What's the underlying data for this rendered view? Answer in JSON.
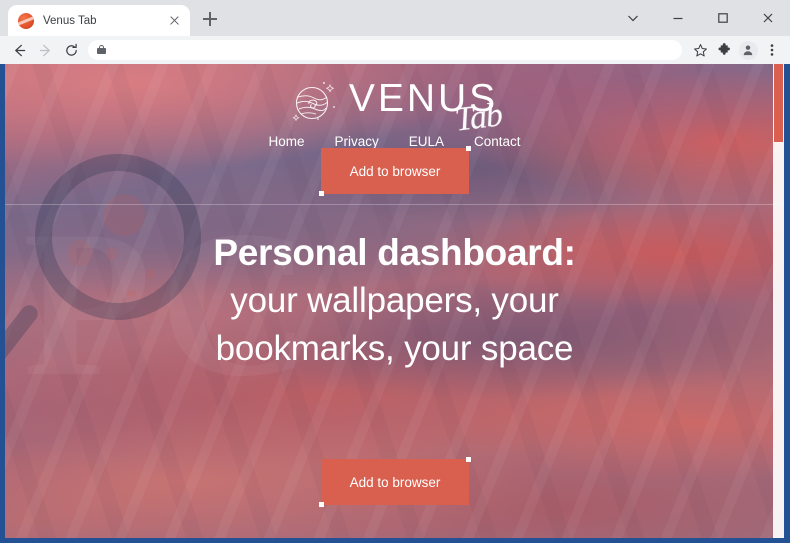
{
  "browser": {
    "tab": {
      "title": "Venus Tab",
      "favicon": "venus-planet-favicon",
      "close_label": "Close tab"
    },
    "new_tab_label": "New tab",
    "window_controls": {
      "minimize_to_tray_label": "Search tabs",
      "minimize_label": "Minimize",
      "maximize_label": "Maximize",
      "close_label": "Close"
    },
    "toolbar": {
      "back_label": "Back",
      "forward_label": "Forward",
      "reload_label": "Reload",
      "omnibox_value": "",
      "omnibox_placeholder": "",
      "lock_icon": "lock-icon",
      "bookmark_label": "Bookmark this tab",
      "extensions_label": "Extensions",
      "profile_label": "Profile",
      "menu_label": "Customize and control Google Chrome"
    }
  },
  "page": {
    "header": {
      "logo": {
        "icon": "venus-planet-icon",
        "wordmark": "VENUS",
        "script": "Tab"
      },
      "nav": [
        {
          "label": "Home"
        },
        {
          "label": "Privacy"
        },
        {
          "label": "EULA"
        },
        {
          "label": "Contact"
        }
      ],
      "cta_label": "Add to browser"
    },
    "hero": {
      "line1": "Personal dashboard:",
      "line2": "your wallpapers, your bookmarks, your space",
      "cta_label": "Add to browser"
    },
    "watermark": {
      "icon": "magnifying-glass-watermark",
      "text": "PC"
    },
    "colors": {
      "cta_background": "#d9604f",
      "cta_text": "#ffffff",
      "nav_text": "#ffffff",
      "hero_text": "#ffffff",
      "scrollbar_thumb": "#d9604f",
      "window_frame": "#245194"
    },
    "scrollbar": {
      "thumb_position_percent": 0,
      "thumb_size_percent": 16
    }
  }
}
